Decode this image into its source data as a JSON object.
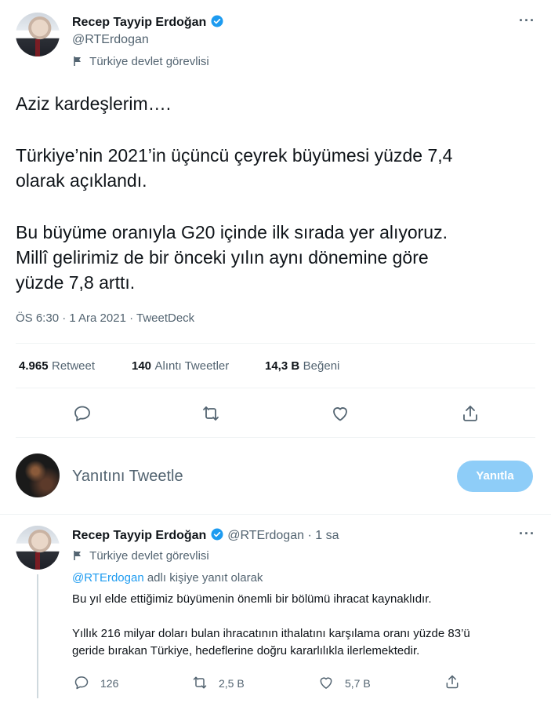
{
  "main_tweet": {
    "author_name": "Recep Tayyip Erdoğan",
    "author_handle": "@RTErdogan",
    "label": "Türkiye devlet görevlisi",
    "text_lines": [
      "Aziz kardeşlerim….",
      "Türkiye’nin 2021’in üçüncü çeyrek büyümesi yüzde 7,4",
      "olarak açıklandı.",
      "Bu büyüme oranıyla G20 içinde ilk sırada yer alıyoruz.",
      "Millî gelirimiz de bir önceki yılın aynı dönemine göre",
      "yüzde 7,8 arttı."
    ],
    "meta": "ÖS 6:30 · 1 Ara 2021 · TweetDeck",
    "stats": {
      "retweets_num": "4.965",
      "retweets_label": "Retweet",
      "quotes_num": "140",
      "quotes_label": "Alıntı Tweetler",
      "likes_num": "14,3 B",
      "likes_label": "Beğeni"
    }
  },
  "compose": {
    "placeholder": "Yanıtını Tweetle",
    "button": "Yanıtla"
  },
  "reply_tweet": {
    "author_name": "Recep Tayyip Erdoğan",
    "author_handle": "@RTErdogan",
    "time": "· 1 sa",
    "label": "Türkiye devlet görevlisi",
    "reply_to_handle": "@RTErdogan",
    "reply_to_suffix": "adlı kişiye yanıt olarak",
    "paragraph1": "Bu yıl elde ettiğimiz büyümenin önemli bir bölümü ihracat kaynaklıdır.",
    "paragraph2_line1": "Yıllık 216 milyar doları bulan ihracatının ithalatını karşılama oranı yüzde 83’ü",
    "paragraph2_line2": "geride bırakan Türkiye, hedeflerine doğru kararlılıkla ilerlemektedir.",
    "replies": "126",
    "retweets": "2,5 B",
    "likes": "5,7 B"
  },
  "colors": {
    "accent": "#1d9bf0",
    "button_disabled": "#8ecdf8",
    "text_primary": "#0f1419",
    "text_secondary": "#536471",
    "divider": "#eff3f4"
  },
  "icons": [
    "verified-badge-icon",
    "flag-icon",
    "more-icon",
    "reply-icon",
    "retweet-icon",
    "like-icon",
    "share-icon"
  ]
}
